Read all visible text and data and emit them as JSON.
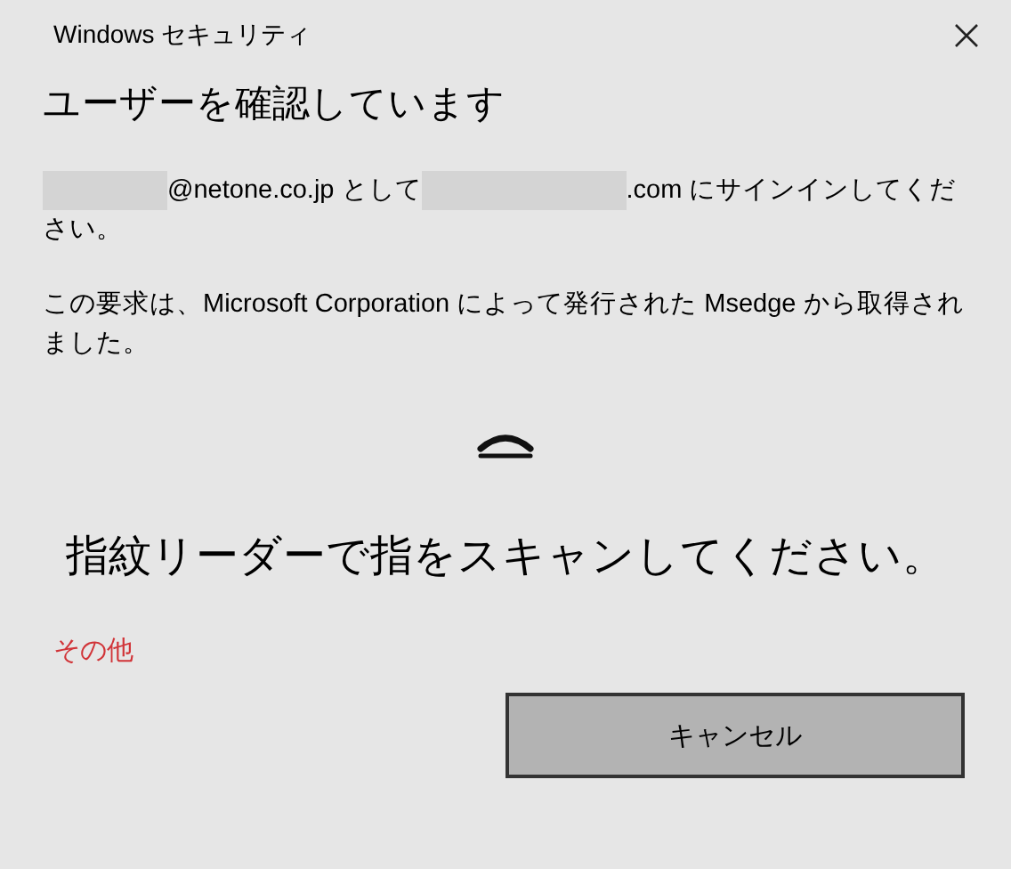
{
  "window": {
    "title": "Windows セキュリティ"
  },
  "heading": "ユーザーを確認しています",
  "sign_in_parts": [
    {
      "kind": "redacted"
    },
    {
      "kind": "text",
      "text": "@netone.co.jp として"
    },
    {
      "kind": "redacted"
    },
    {
      "kind": "text",
      "text": ".com にサインインしてください。"
    }
  ],
  "request_text": "この要求は、Microsoft Corporation によって発行された Msedge から取得されました。",
  "prompt": "指紋リーダーで指をスキャンしてください。",
  "more_link": "その他",
  "buttons": [
    {
      "label": "キャンセル"
    }
  ]
}
